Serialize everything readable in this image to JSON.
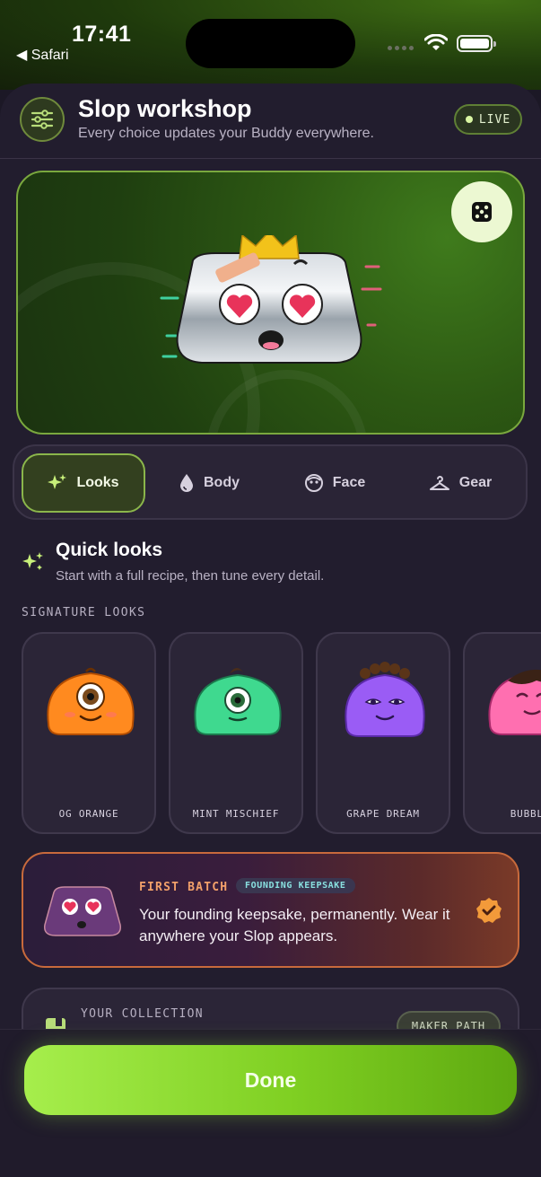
{
  "status_bar": {
    "time": "17:41",
    "back_app": "◀ Safari"
  },
  "header": {
    "title": "Slop workshop",
    "subtitle": "Every choice updates your Buddy everywhere.",
    "live_badge": "LIVE",
    "icon": "sliders-icon"
  },
  "preview": {
    "randomize_icon": "dice-icon"
  },
  "tabs": [
    {
      "label": "Looks",
      "icon": "sparkles-icon",
      "active": true
    },
    {
      "label": "Body",
      "icon": "drop-icon",
      "active": false
    },
    {
      "label": "Face",
      "icon": "face-icon",
      "active": false
    },
    {
      "label": "Gear",
      "icon": "hanger-icon",
      "active": false
    }
  ],
  "quick_looks": {
    "title": "Quick looks",
    "subtitle": "Start with a full recipe, then tune every detail.",
    "section_label": "SIGNATURE LOOKS",
    "looks": [
      {
        "name": "OG ORANGE",
        "color": "#ff8a1f"
      },
      {
        "name": "MINT MISCHIEF",
        "color": "#3fd98f"
      },
      {
        "name": "GRAPE DREAM",
        "color": "#9a5cf5"
      },
      {
        "name": "BUBBLE",
        "color": "#ff6fb0"
      }
    ]
  },
  "first_batch": {
    "tag": "FIRST BATCH",
    "badge": "FOUNDING KEEPSAKE",
    "text": "Your founding keepsake, permanently. Wear it anywhere your Slop appears."
  },
  "collection": {
    "label": "YOUR COLLECTION",
    "badge": "MAKER PATH"
  },
  "done_button": "Done",
  "colors": {
    "accent": "#8bd43a",
    "background": "#221d2e"
  }
}
